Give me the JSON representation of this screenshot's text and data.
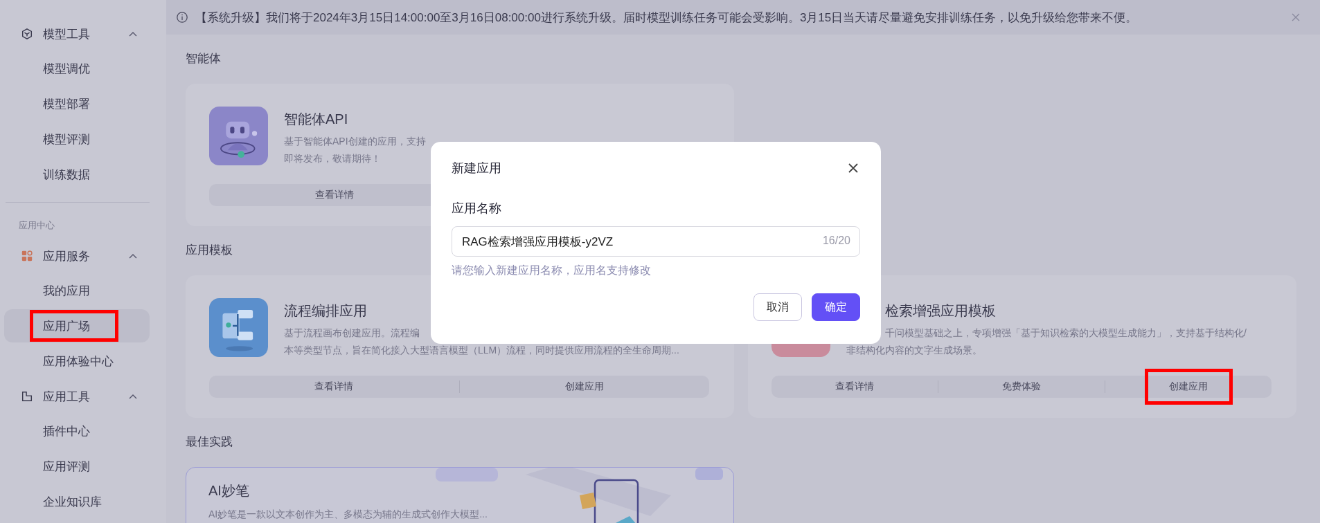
{
  "notice": {
    "text": "【系统升级】我们将于2024年3月15日14:00:00至3月16日08:00:00进行系统升级。届时模型训练任务可能会受影响。3月15日当天请尽量避免安排训练任务，以免升级给您带来不便。"
  },
  "sidebar": {
    "top_groups": [
      {
        "label": "模型工具",
        "kind": "cube",
        "expanded": true,
        "items": [
          {
            "label": "模型调优",
            "selected": false,
            "highlighted": false
          },
          {
            "label": "模型部署",
            "selected": false,
            "highlighted": false
          },
          {
            "label": "模型评测",
            "selected": false,
            "highlighted": false
          },
          {
            "label": "训练数据",
            "selected": false,
            "highlighted": false
          }
        ]
      }
    ],
    "section_label": "应用中心",
    "groups": [
      {
        "label": "应用服务",
        "kind": "grid",
        "expanded": true,
        "items": [
          {
            "label": "我的应用",
            "selected": false,
            "highlighted": false
          },
          {
            "label": "应用广场",
            "selected": true,
            "highlighted": true
          },
          {
            "label": "应用体验中心",
            "selected": false,
            "highlighted": false
          }
        ]
      },
      {
        "label": "应用工具",
        "kind": "doc",
        "expanded": true,
        "items": [
          {
            "label": "插件中心",
            "selected": false,
            "highlighted": false
          },
          {
            "label": "应用评测",
            "selected": false,
            "highlighted": false
          },
          {
            "label": "企业知识库",
            "selected": false,
            "highlighted": false
          }
        ]
      }
    ]
  },
  "agent_section": {
    "heading": "智能体",
    "cards": [
      {
        "title": "智能体API",
        "description": [
          "基于智能体API创建的应用，支持",
          "即将发布，敬请期待！"
        ],
        "actions": [
          {
            "label": "查看详情",
            "highlighted": false
          }
        ]
      }
    ]
  },
  "template_section": {
    "heading": "应用模板",
    "cards": [
      {
        "title": "流程编排应用",
        "description": [
          "基于流程画布创建应用。流程编",
          "本等类型节点，旨在简化接入大型语言模型（LLM）流程，同时提供应用流程的全生命周期..."
        ],
        "actions": [
          {
            "label": "查看详情",
            "highlighted": false
          },
          {
            "label": "创建应用",
            "highlighted": false
          }
        ]
      },
      {
        "title": "检索增强应用模板",
        "description": [
          "千问模型基础之上，专项增强「基于知识检索的大模型生成能力」，支持基于结构化/",
          "非结构化内容的文字生成场景。"
        ],
        "actions": [
          {
            "label": "查看详情",
            "highlighted": false
          },
          {
            "label": "免费体验",
            "highlighted": false
          },
          {
            "label": "创建应用",
            "highlighted": true
          }
        ]
      }
    ]
  },
  "practice_section": {
    "heading": "最佳实践",
    "cards": [
      {
        "title": "AI妙笔",
        "description": "AI妙笔是一款以文本创作为主、多模态为辅的生成式创作大模型..."
      }
    ]
  },
  "dialog": {
    "title": "新建应用",
    "field_label": "应用名称",
    "value": "RAG检索增强应用模板-y2VZ",
    "counter": "16/20",
    "hint": "请您输入新建应用名称，应用名支持修改",
    "buttons": [
      {
        "label": "取消",
        "kind": "secondary"
      },
      {
        "label": "确定",
        "kind": "primary"
      }
    ]
  }
}
